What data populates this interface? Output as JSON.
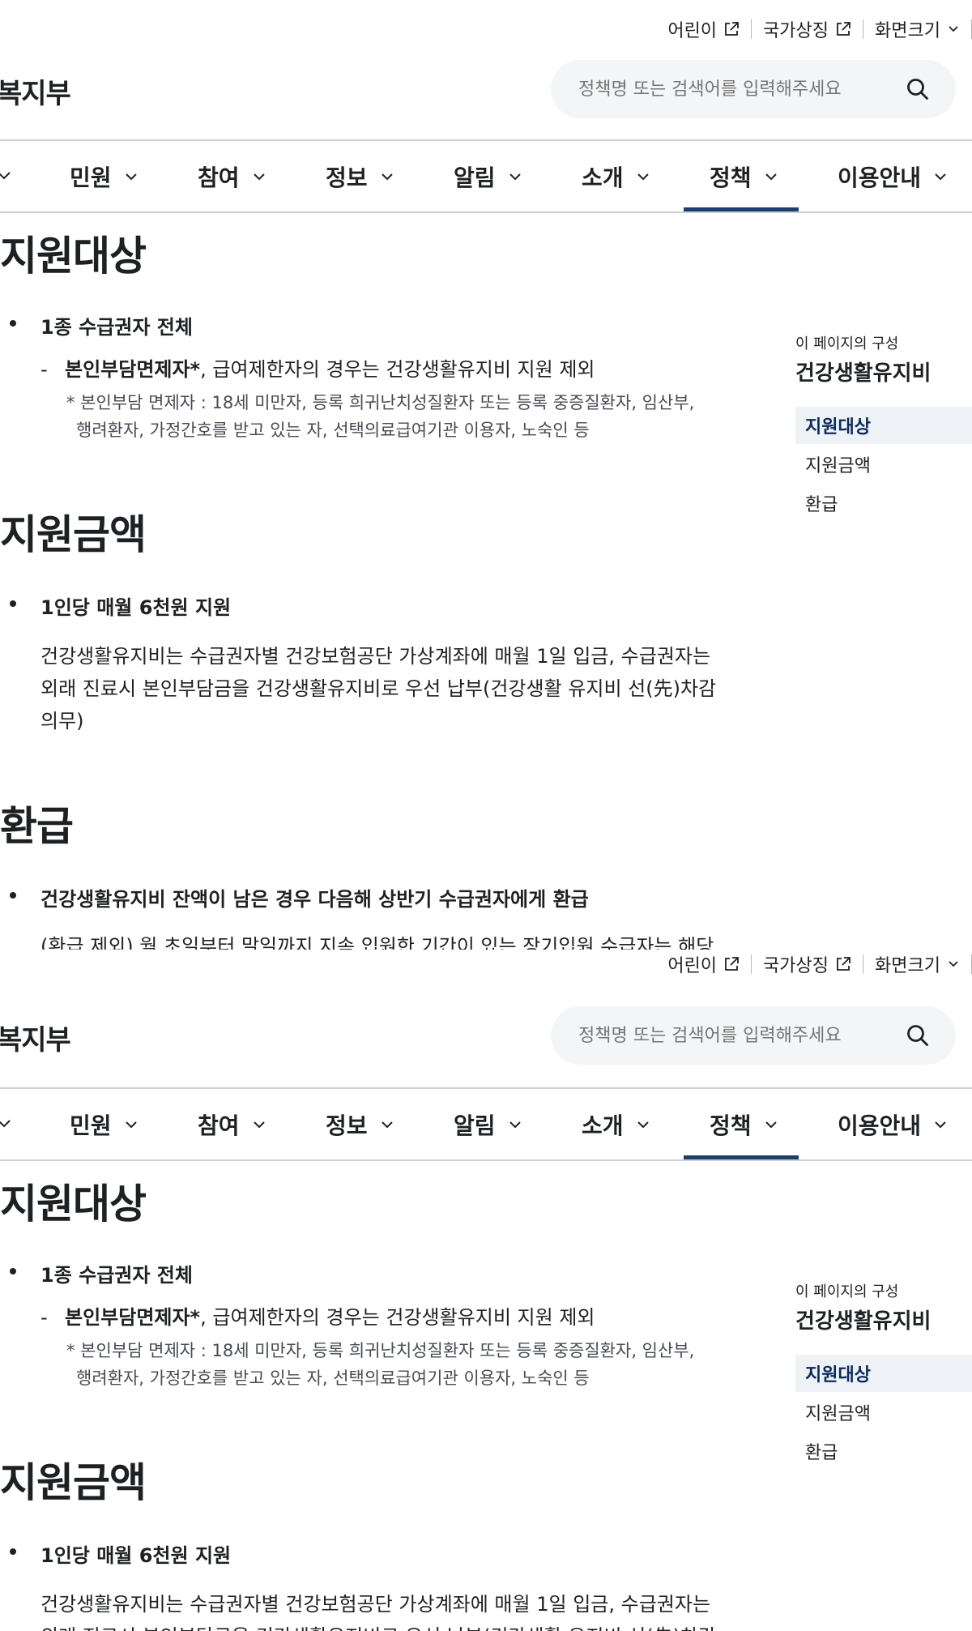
{
  "utility": {
    "kids": "어린이",
    "national_symbol": "국가상징",
    "font_size": "화면크기"
  },
  "logo_text": "보건복지부",
  "logo_visible": "복지부",
  "search": {
    "placeholder": "정책명 또는 검색어를 입력해주세요"
  },
  "nav": {
    "tabs": [
      "민원",
      "참여",
      "정보",
      "알림",
      "소개",
      "정책",
      "이용안내"
    ],
    "active": "정책"
  },
  "toc": {
    "caption": "이 페이지의 구성",
    "title": "건강생활유지비",
    "items": [
      "지원대상",
      "지원금액",
      "환급"
    ],
    "active": "지원대상"
  },
  "sections": {
    "target": {
      "heading": "지원대상",
      "bullet": "1종 수급권자 전체",
      "dash_bold": "본인부담면제자*",
      "dash_rest": ", 급여제한자의 경우는 건강생활유지비 지원 제외",
      "note_line1": "* 본인부담 면제자 : 18세 미만자, 등록 희귀난치성질환자 또는 등록 중증질환자, 임산부,",
      "note_line2": "행려환자, 가정간호를 받고 있는 자, 선택의료급여기관 이용자, 노숙인 등"
    },
    "amount": {
      "heading": "지원금액",
      "bullet": "1인당 매월 6천원 지원",
      "para_line1": "건강생활유지비는 수급권자별 건강보험공단 가상계좌에 매월 1일 입금, 수급권자는",
      "para_line2": "외래 진료시 본인부담금을 건강생활유지비로 우선 납부(건강생활 유지비 선(先)차감",
      "para_line3": "의무)"
    },
    "refund": {
      "heading": "환급",
      "bullet": "건강생활유지비 잔액이 남은 경우 다음해 상반기 수급권자에게 환급",
      "cut_line": "(환급 제외) 월 초일부터 말일까지 지속 입원한 기간이 있는 장기입원 수급자는 해당"
    }
  }
}
